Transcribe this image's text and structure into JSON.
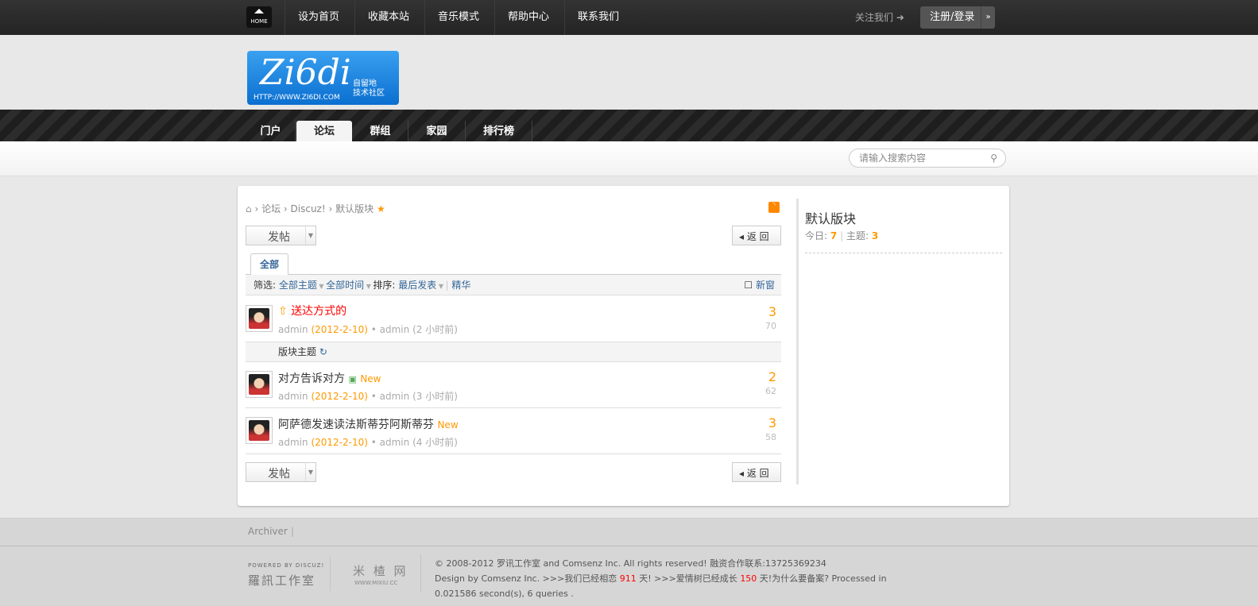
{
  "topbar": {
    "home_label": "HOME",
    "links": [
      "设为首页",
      "收藏本站",
      "音乐模式",
      "帮助中心",
      "联系我们"
    ],
    "follow": "关注我们",
    "login": "注册/登录"
  },
  "logo": {
    "text": "Zi6di",
    "cn": "自留地 技术社区",
    "url": "HTTP://WWW.ZI6DI.COM"
  },
  "nav": [
    "门户",
    "论坛",
    "群组",
    "家园",
    "排行榜"
  ],
  "search": {
    "placeholder": "请输入搜索内容"
  },
  "breadcrumb": [
    "论坛",
    "Discuz!",
    "默认版块"
  ],
  "post_button": "发帖",
  "back_button": "返 回",
  "tab": "全部",
  "filter": {
    "label": "筛选:",
    "type": "全部主题",
    "time": "全部时间",
    "sort_label": "排序:",
    "sort": "最后发表",
    "digest": "精华",
    "newwin": "新窗"
  },
  "threads_sticky": [
    {
      "title": "送达方式的",
      "author": "admin",
      "date": "(2012-2-10)",
      "last": "admin",
      "ago": "(2 小时前)",
      "replies": "3",
      "views": "70"
    }
  ],
  "section_label": "版块主题",
  "threads": [
    {
      "title": "对方告诉对方",
      "badge": "New",
      "author": "admin",
      "date": "(2012-2-10)",
      "last": "admin",
      "ago": "(3 小时前)",
      "replies": "2",
      "views": "62"
    },
    {
      "title": "阿萨德发速读法斯蒂芬阿斯蒂芬",
      "badge": "New",
      "author": "admin",
      "date": "(2012-2-10)",
      "last": "admin",
      "ago": "(4 小时前)",
      "replies": "3",
      "views": "58"
    }
  ],
  "sidebar": {
    "title": "默认版块",
    "today_label": "今日:",
    "today": "7",
    "topics_label": "主题:",
    "topics": "3"
  },
  "footer": {
    "archiver": "Archiver",
    "powered": "POWERED BY DISCUZ!",
    "studio": "羅訊工作室",
    "mixiu": "米 楂 网",
    "mixiu_url": "WWW.MIXIU.CC",
    "line1": "© 2008-2012 罗讯工作室  and Comsenz Inc.  All rights reserved! 融资合作联系:13725369234",
    "line2a": "Design by Comsenz Inc.   >>>我们已经相恋 ",
    "days1": "911",
    "line2b": " 天! >>>爱情树已经成长 ",
    "days2": "150",
    "line2c": " 天!为什么要备案? Processed in",
    "line3": "0.021586 second(s), 6 queries ."
  }
}
